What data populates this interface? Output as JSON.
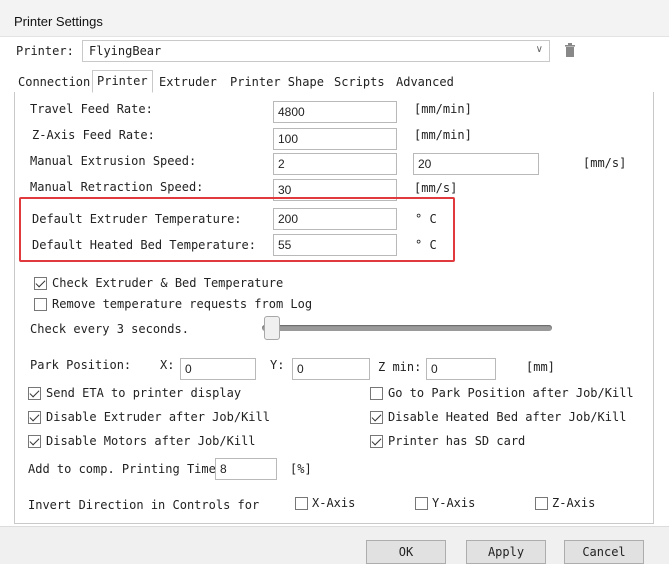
{
  "window": {
    "title": "Printer Settings"
  },
  "printer": {
    "label": "Printer:",
    "selected": "FlyingBear"
  },
  "tabs": [
    {
      "label": "Connection",
      "active": false
    },
    {
      "label": "Printer",
      "active": true
    },
    {
      "label": "Extruder",
      "active": false
    },
    {
      "label": "Printer Shape",
      "active": false
    },
    {
      "label": "Scripts",
      "active": false
    },
    {
      "label": "Advanced",
      "active": false
    }
  ],
  "fields": {
    "travel_feed": {
      "label": "Travel Feed Rate:",
      "value": "4800",
      "unit": "[mm/min]"
    },
    "z_feed": {
      "label": "Z-Axis Feed Rate:",
      "value": "100",
      "unit": "[mm/min]"
    },
    "manual_extrusion": {
      "label": "Manual Extrusion Speed:",
      "value": "2",
      "value2": "20",
      "unit": "[mm/s]"
    },
    "manual_retraction": {
      "label": "Manual Retraction Speed:",
      "value": "30",
      "unit": "[mm/s]"
    },
    "extruder_temp": {
      "label": "Default Extruder Temperature:",
      "value": "200",
      "unit": "° C"
    },
    "bed_temp": {
      "label": "Default Heated Bed Temperature:",
      "value": "55",
      "unit": "° C"
    }
  },
  "checks": {
    "check_temp": {
      "label": "Check Extruder & Bed Temperature",
      "checked": true
    },
    "remove_temp_requests": {
      "label": "Remove temperature requests from Log",
      "checked": false
    },
    "send_eta": {
      "label": "Send ETA to printer display",
      "checked": true
    },
    "go_park": {
      "label": "Go to Park Position after Job/Kill",
      "checked": false
    },
    "disable_extruder": {
      "label": "Disable Extruder after Job/Kill",
      "checked": true
    },
    "disable_bed": {
      "label": "Disable Heated Bed after Job/Kill",
      "checked": true
    },
    "disable_motors": {
      "label": "Disable Motors after Job/Kill",
      "checked": true
    },
    "has_sd": {
      "label": "Printer has SD card",
      "checked": true
    },
    "invert_x": {
      "label": "X-Axis",
      "checked": false
    },
    "invert_y": {
      "label": "Y-Axis",
      "checked": false
    },
    "invert_z": {
      "label": "Z-Axis",
      "checked": false
    }
  },
  "check_interval": {
    "label": "Check every 3 seconds.",
    "level": 0.03
  },
  "park": {
    "label": "Park Position:",
    "x_label": "X:",
    "x": "0",
    "y_label": "Y:",
    "y": "0",
    "zmin_label": "Z min:",
    "zmin": "0",
    "unit": "[mm]"
  },
  "comp": {
    "label": "Add to comp. Printing Time",
    "value": "8",
    "unit": "[%]"
  },
  "invert": {
    "label": "Invert Direction in Controls for"
  },
  "buttons": {
    "ok": "OK",
    "apply": "Apply",
    "cancel": "Cancel"
  },
  "colors": {
    "highlight": "#e0393e"
  }
}
